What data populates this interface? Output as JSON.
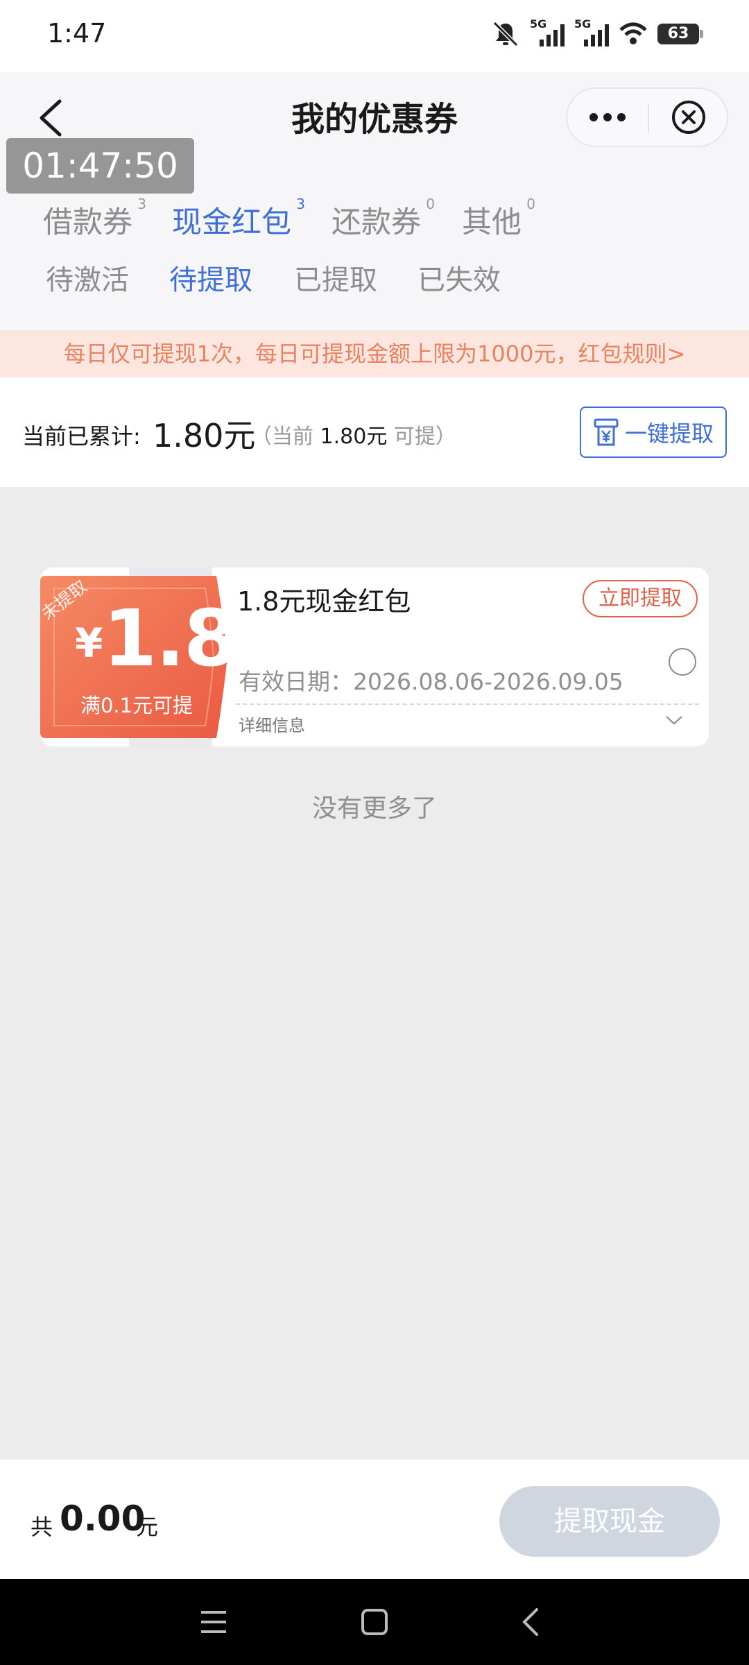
{
  "status_bar": {
    "time": "1:47",
    "battery": "63",
    "network": "5G"
  },
  "header": {
    "title": "我的优惠券"
  },
  "timer_overlay": "01:47:50",
  "tabs": [
    {
      "label": "借款券",
      "count": "3"
    },
    {
      "label": "现金红包",
      "count": "3"
    },
    {
      "label": "还款券",
      "count": "0"
    },
    {
      "label": "其他",
      "count": "0"
    }
  ],
  "sub_tabs": [
    {
      "label": "待激活"
    },
    {
      "label": "待提取"
    },
    {
      "label": "已提取"
    },
    {
      "label": "已失效"
    }
  ],
  "notice": "每日仅可提现1次，每日可提现金额上限为1000元，红包规则>",
  "summary": {
    "label": "当前已累计:",
    "amount": "1.80元",
    "sub_prefix": "（当前",
    "sub_amount": "1.80元",
    "sub_suffix": "可提）",
    "button_label": "一键提取"
  },
  "coupon": {
    "ribbon": "未提取",
    "currency": "¥",
    "value": "1.8",
    "condition": "满0.1元可提",
    "title": "1.8元现金红包",
    "action_label": "立即提取",
    "validity": "有效日期：2026.08.06-2026.09.05",
    "detail_label": "详细信息"
  },
  "list_end": "没有更多了",
  "bottom_bar": {
    "total_label": "共",
    "total_amount": "0.00",
    "total_unit": "元",
    "withdraw_label": "提取现金"
  },
  "colors": {
    "accent": "#3d6fd6",
    "coupon_orange": "#ef6a4f",
    "notice_bg": "#fde6e0",
    "notice_text": "#e8835f",
    "disabled_button": "#cfd6e0"
  }
}
